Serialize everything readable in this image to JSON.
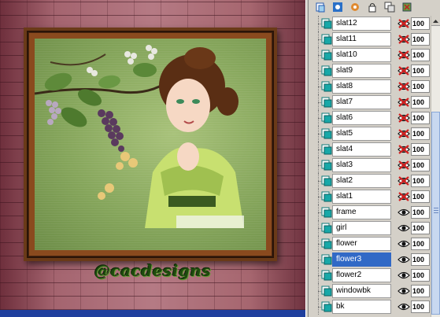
{
  "canvas": {
    "watermark": "@cacdesigns"
  },
  "panel": {
    "toolbar": [
      {
        "name": "new-layer-icon"
      },
      {
        "name": "new-mask-icon"
      },
      {
        "name": "adjustment-icon"
      },
      {
        "name": "lock-icon"
      },
      {
        "name": "duplicate-icon"
      },
      {
        "name": "delete-layer-icon"
      }
    ],
    "layers": [
      {
        "label": "slat12",
        "visible": false,
        "opacity": "100"
      },
      {
        "label": "slat11",
        "visible": false,
        "opacity": "100"
      },
      {
        "label": "slat10",
        "visible": false,
        "opacity": "100"
      },
      {
        "label": "slat9",
        "visible": false,
        "opacity": "100"
      },
      {
        "label": "slat8",
        "visible": false,
        "opacity": "100"
      },
      {
        "label": "slat7",
        "visible": false,
        "opacity": "100"
      },
      {
        "label": "slat6",
        "visible": false,
        "opacity": "100"
      },
      {
        "label": "slat5",
        "visible": false,
        "opacity": "100"
      },
      {
        "label": "slat4",
        "visible": false,
        "opacity": "100"
      },
      {
        "label": "slat3",
        "visible": false,
        "opacity": "100"
      },
      {
        "label": "slat2",
        "visible": false,
        "opacity": "100"
      },
      {
        "label": "slat1",
        "visible": false,
        "opacity": "100"
      },
      {
        "label": "frame",
        "visible": true,
        "opacity": "100"
      },
      {
        "label": "girl",
        "visible": true,
        "opacity": "100"
      },
      {
        "label": "flower",
        "visible": true,
        "opacity": "100"
      },
      {
        "label": "flower3",
        "visible": true,
        "opacity": "100",
        "selected": true
      },
      {
        "label": "flower2",
        "visible": true,
        "opacity": "100"
      },
      {
        "label": "windowbk",
        "visible": true,
        "opacity": "100"
      },
      {
        "label": "bk",
        "visible": true,
        "opacity": "100"
      }
    ]
  },
  "colors": {
    "selection": "#3169c6",
    "hidden_x": "#d42020",
    "thumb": "#18a8a8"
  }
}
